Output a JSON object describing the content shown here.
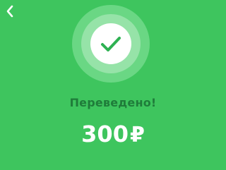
{
  "header": {
    "back_icon": "chevron-left-icon"
  },
  "status": {
    "icon": "checkmark-icon",
    "text": "Переведено!"
  },
  "transfer": {
    "amount": "300",
    "currency_symbol": "₽"
  },
  "colors": {
    "background": "#3ec55e",
    "status_text": "#1f7c3a",
    "check_stroke": "#2eb152",
    "amount_text": "#ffffff"
  }
}
